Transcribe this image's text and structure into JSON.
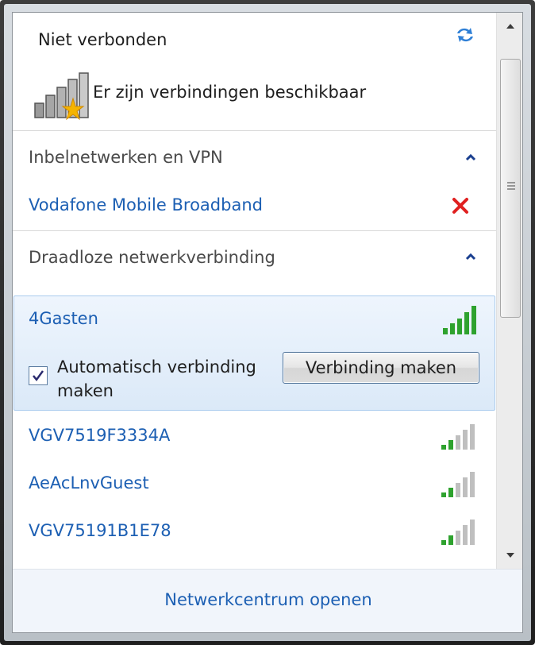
{
  "header": {
    "title": "Niet verbonden",
    "status_text": "Er zijn verbindingen beschikbaar",
    "refresh_icon": "refresh-icon",
    "status_icon": "signal-bars-with-star-icon"
  },
  "sections": {
    "dialup": {
      "label": "Inbelnetwerken en VPN",
      "items": [
        {
          "label": "Vodafone Mobile Broadband",
          "status": "not-available"
        }
      ]
    },
    "wireless": {
      "label": "Draadloze netwerkverbinding",
      "selected": {
        "name": "4Gasten",
        "signal_bars": 5,
        "auto_connect_label": "Automatisch verbinding maken",
        "auto_connect_checked": true,
        "connect_button_label": "Verbinding maken"
      },
      "networks": [
        {
          "name": "VGV7519F3334A",
          "signal_bars": 2
        },
        {
          "name": "AeAcLnvGuest",
          "signal_bars": 2
        },
        {
          "name": "VGV75191B1E78",
          "signal_bars": 2
        }
      ]
    }
  },
  "footer": {
    "link_label": "Netwerkcentrum openen"
  },
  "colors": {
    "link": "#1c5fb3",
    "signal_active": "#2ea22e",
    "signal_inactive": "#bfbfbf",
    "error_x": "#e02020",
    "selected_bg": "#dbe9f8"
  }
}
